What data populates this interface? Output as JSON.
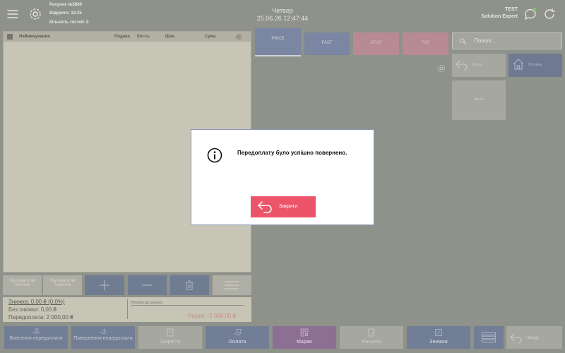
{
  "header": {
    "receipt": "Рахунок №5860",
    "opened": "Відкрито: 12:25",
    "guests": "Кількість гостей: 0",
    "weekday": "Четвер",
    "datetime": "25.06.26 12:47:44",
    "user_name": "TEST",
    "company": "Solution Expert"
  },
  "order_table": {
    "columns": [
      "Найменування",
      "Подача",
      "Кіл-ть",
      "Ціна",
      "Сума"
    ]
  },
  "order_actions": {
    "group_by_guests": "Групувати за гостями",
    "group_by_serving": "Групувати за подачею"
  },
  "summary": {
    "discount": "Знижка: 0,00 ₴ (0,0%)",
    "without_discount": "Без знижки: 0,00 ₴",
    "prepayment": "Передоплата: 2 000,00 ₴",
    "receipt_note": "Нотатка до рахунку",
    "total": "Разом: -2 000,00 ₴"
  },
  "price_tabs": [
    "PRICE",
    "FAST",
    "STOP",
    "TOP"
  ],
  "search": {
    "placeholder": "Пошук..."
  },
  "menu_tiles": {
    "back": "Назад",
    "home": "Головна",
    "menu": "Меню"
  },
  "bottom_buttons": {
    "deposit": "Внесення передоплати",
    "return": "Повернення передоплати",
    "settle": "Закриття",
    "payment": "Оплата",
    "marks": "Марки",
    "receipt": "Рахунок",
    "discounts": "Знижки",
    "back": "Назад"
  },
  "dialog": {
    "message": "Передоплату було успішно повернено.",
    "close_label": "Закрити"
  },
  "colors": {
    "overlay": "#8e928a",
    "accent_red": "#ec5569",
    "tab_price": "#7b86a2",
    "tab_fast": "#7b86a2",
    "tab_stop": "#b88a91",
    "tab_top": "#b88a91",
    "bottom_blue": "#6f7c92",
    "bottom_pink": "#8c6f92"
  }
}
